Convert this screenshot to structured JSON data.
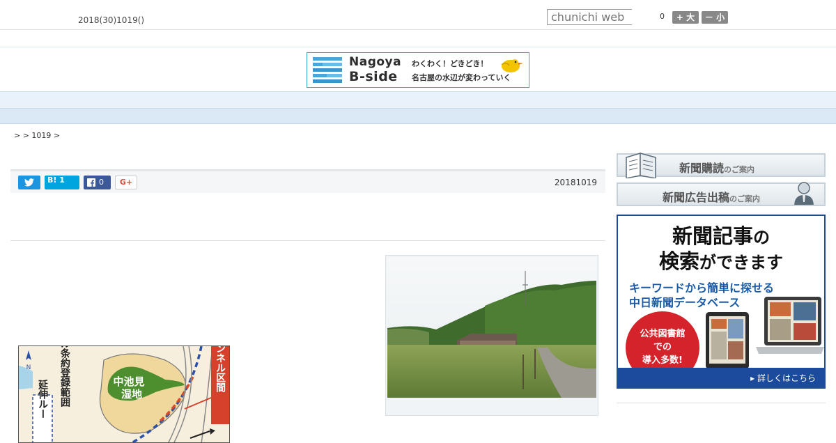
{
  "header": {
    "date": "2018(30)1019()",
    "search_placeholder": "chunichi web",
    "font_size_value": "0",
    "font_larger_label": "+ 大",
    "font_smaller_label": "－ 小"
  },
  "banner": {
    "name_line1": "Nagoya",
    "name_line2": "B-side",
    "tagline1": "わくわく！どきどき！",
    "tagline2": "名古屋の水辺が変わっていく"
  },
  "nav": {
    "items": [
      "",
      "",
      "",
      "",
      "",
      "",
      "",
      "",
      ""
    ]
  },
  "breadcrumb": " >  > 1019 > ",
  "share": {
    "hatena_label": "B! 1",
    "facebook_count": "0",
    "gplus_label": "G+"
  },
  "article": {
    "date": "20181019"
  },
  "map": {
    "wetland_label_1": "中池見",
    "wetland_label_2": "湿地",
    "ramsar_label": "ラムサール条約登録範囲",
    "tunnel_label": "トンネル区間",
    "extension_label": "延伸ルー",
    "north_label": "N"
  },
  "sidebar": {
    "subscribe_main": "新聞購読",
    "subscribe_sub": "のご案内",
    "ad_main": "新聞広告出稿",
    "ad_sub": "のご案内",
    "promo": {
      "line1a": "新聞記事",
      "line1b": "の",
      "line2a": "検索",
      "line2b": "ができます",
      "sub1": "キーワードから簡単に探せる",
      "sub2": "中日新聞データベース",
      "circle1": "公共図書館",
      "circle2": "での",
      "circle3": "導入多数!",
      "more": "▸ 詳しくはこちら"
    }
  },
  "colors": {
    "nav_bg": "#e9f2fa",
    "twitter": "#1b95e0",
    "hatena": "#00a4de",
    "facebook": "#3b5998",
    "promo_blue": "#1c4a9c",
    "promo_red": "#d4232a"
  }
}
